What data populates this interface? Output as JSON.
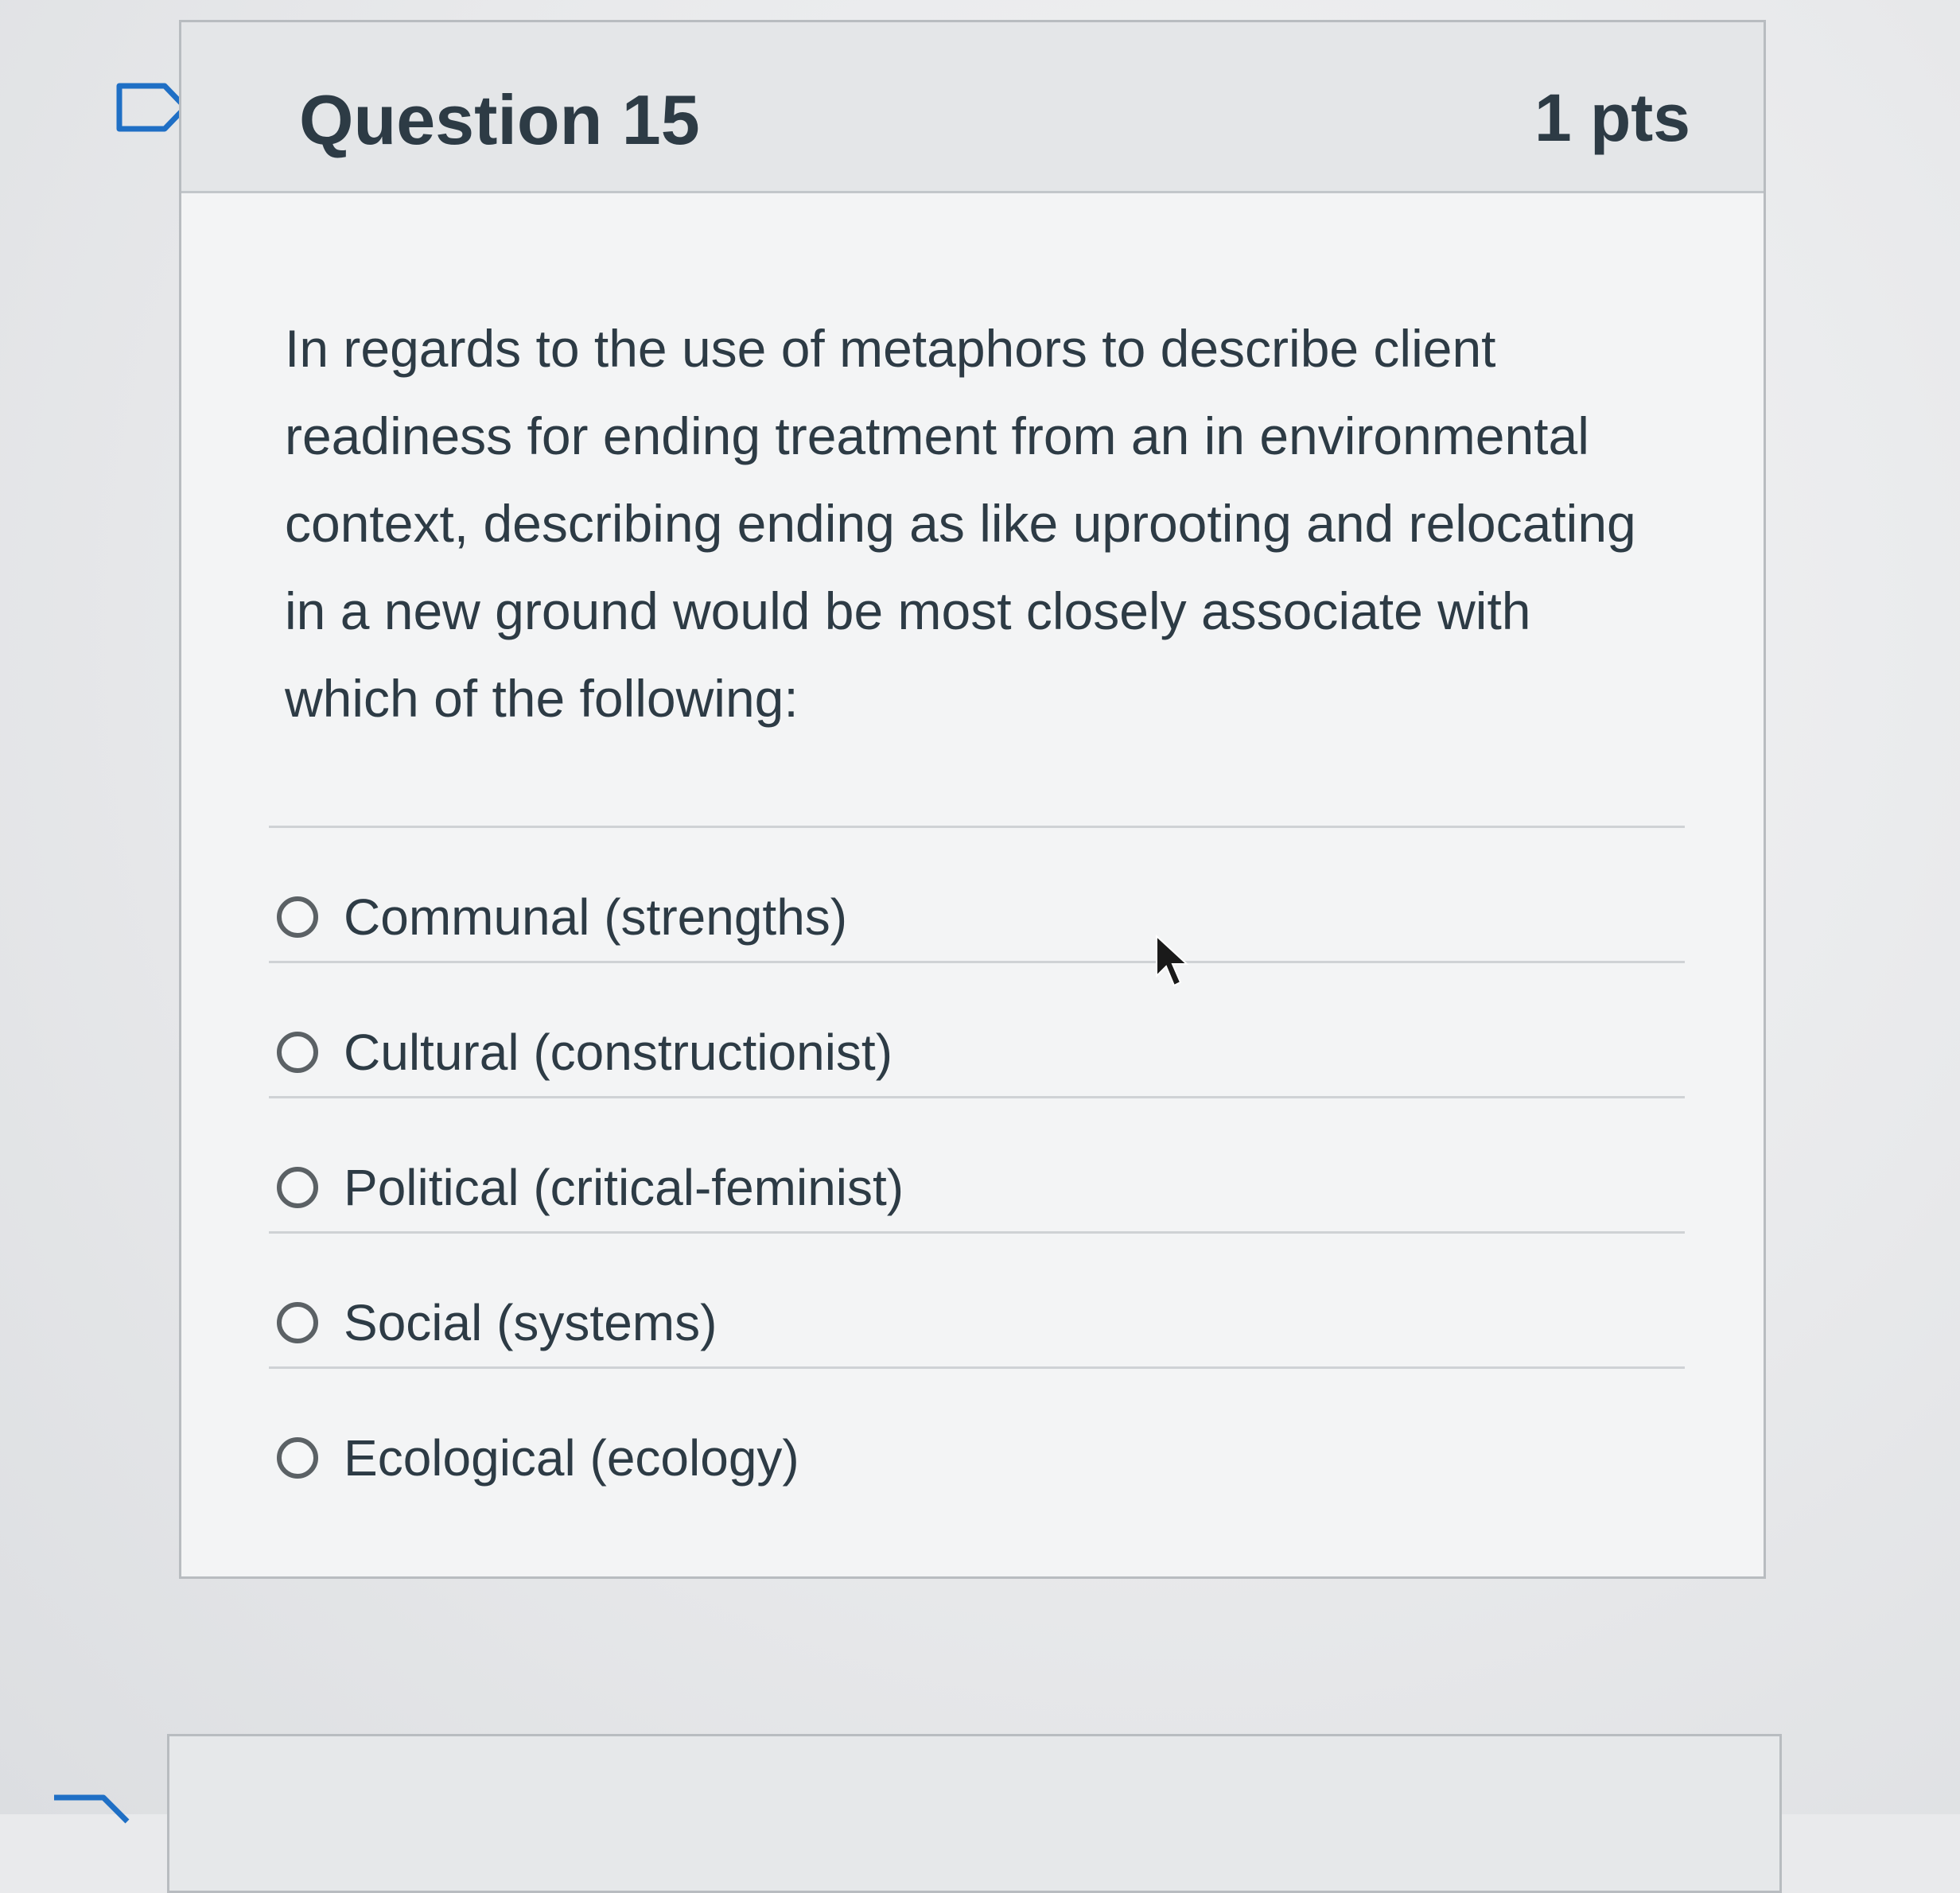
{
  "question": {
    "title": "Question 15",
    "points": "1 pts",
    "text": "In regards to the use of metaphors to describe client readiness for ending treatment from an in environmental context, describing ending as like uprooting and relocating in a new ground would be most closely associate with which of the following:",
    "bookmark_icon": "bookmark-flag-icon"
  },
  "answers": [
    {
      "label": "Communal (strengths)",
      "selected": false
    },
    {
      "label": "Cultural (constructionist)",
      "selected": false
    },
    {
      "label": "Political (critical-feminist)",
      "selected": false
    },
    {
      "label": "Social (systems)",
      "selected": false
    },
    {
      "label": "Ecological (ecology)",
      "selected": false
    }
  ],
  "cursor_icon": "mouse-pointer-icon",
  "colors": {
    "text": "#2d3b45",
    "header_bg": "#e4e6e8",
    "border": "#b8bcc0",
    "radio_border": "#5b6165"
  }
}
